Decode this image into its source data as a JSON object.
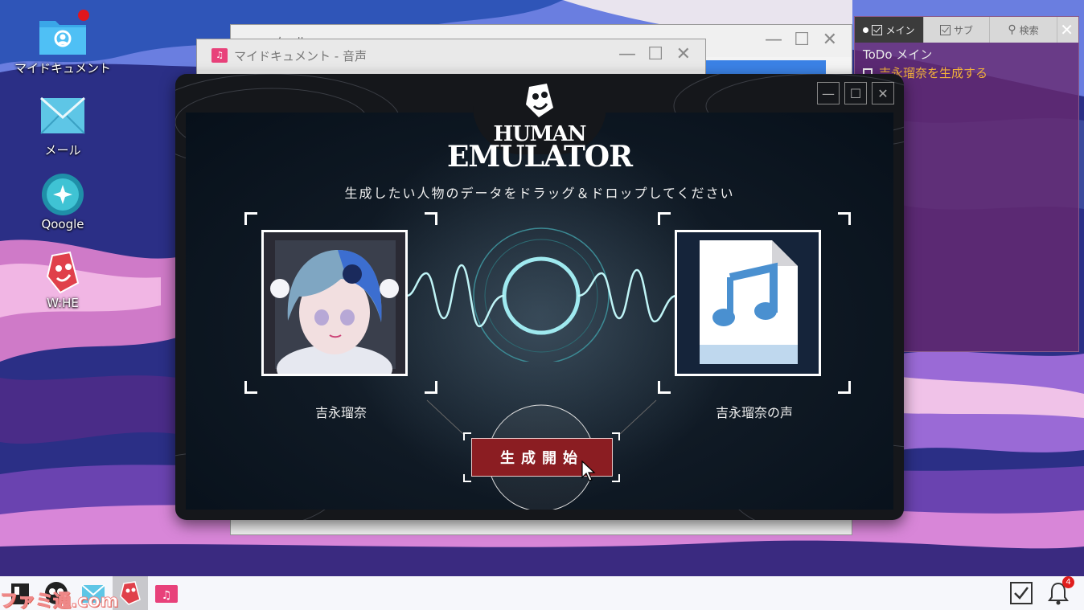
{
  "desktop": {
    "icons": [
      {
        "label": "マイドキュメント",
        "icon": "folder-user-icon"
      },
      {
        "label": "メール",
        "icon": "mail-icon"
      },
      {
        "label": "Qoogle",
        "icon": "browser-icon"
      },
      {
        "label": "W:HE",
        "icon": "whe-app-icon"
      }
    ]
  },
  "background_window": {
    "title": "マイドキュメント - 音声",
    "behind_title": "メール"
  },
  "todo_panel": {
    "tabs": [
      {
        "label": "メイン",
        "active": true
      },
      {
        "label": "サブ",
        "active": false
      },
      {
        "label": "検索",
        "active": false
      }
    ],
    "title": "ToDo メイン",
    "items": [
      {
        "text": "吉永瑠奈を生成する"
      }
    ]
  },
  "app": {
    "logo_line1": "HUMAN",
    "logo_line2": "EMULATOR",
    "instruction": "生成したい人物のデータをドラッグ＆ドロップしてください",
    "left_slot": {
      "label": "吉永瑠奈"
    },
    "right_slot": {
      "label": "吉永瑠奈の声",
      "file_type": "music-file-icon"
    },
    "generate_button": "生成開始"
  },
  "taskbar": {
    "notification_count": "4",
    "watermark": "ファミ通.com"
  },
  "colors": {
    "accent_button": "#8b1d22",
    "wave": "#8fe3e8",
    "todo_item": "#f2b13a"
  }
}
